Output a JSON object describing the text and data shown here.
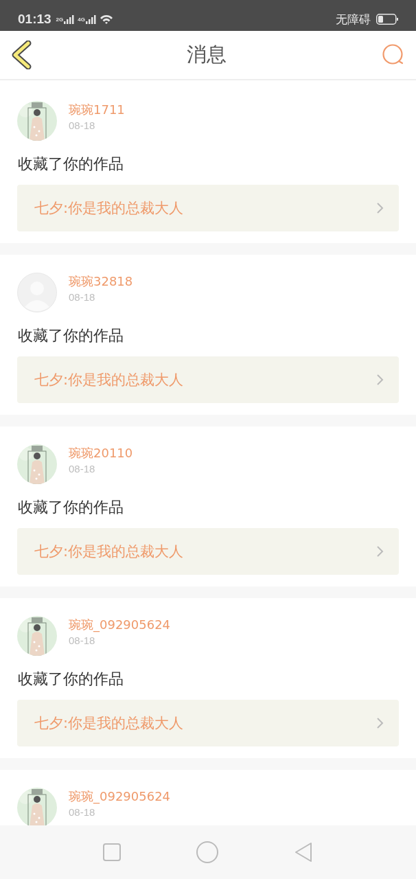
{
  "status_bar": {
    "time": "01:13",
    "networks": [
      "2G",
      "4G"
    ],
    "accessibility": "无障碍"
  },
  "header": {
    "title": "消息"
  },
  "messages": [
    {
      "name": "琬琬1711",
      "date": "08-18",
      "action": "收藏了你的作品",
      "work": "七夕:你是我的总裁大人"
    },
    {
      "name": "琬琬32818",
      "date": "08-18",
      "action": "收藏了你的作品",
      "work": "七夕:你是我的总裁大人",
      "avatar": {
        "kind": "default"
      }
    },
    {
      "name": "琬琬20110",
      "date": "08-18",
      "action": "收藏了你的作品",
      "work": "七夕:你是我的总裁大人"
    },
    {
      "name": "琬琬_092905624",
      "date": "08-18",
      "action": "收藏了你的作品",
      "work": "七夕:你是我的总裁大人"
    },
    {
      "name": "琬琬_092905624",
      "date": "08-18"
    }
  ]
}
